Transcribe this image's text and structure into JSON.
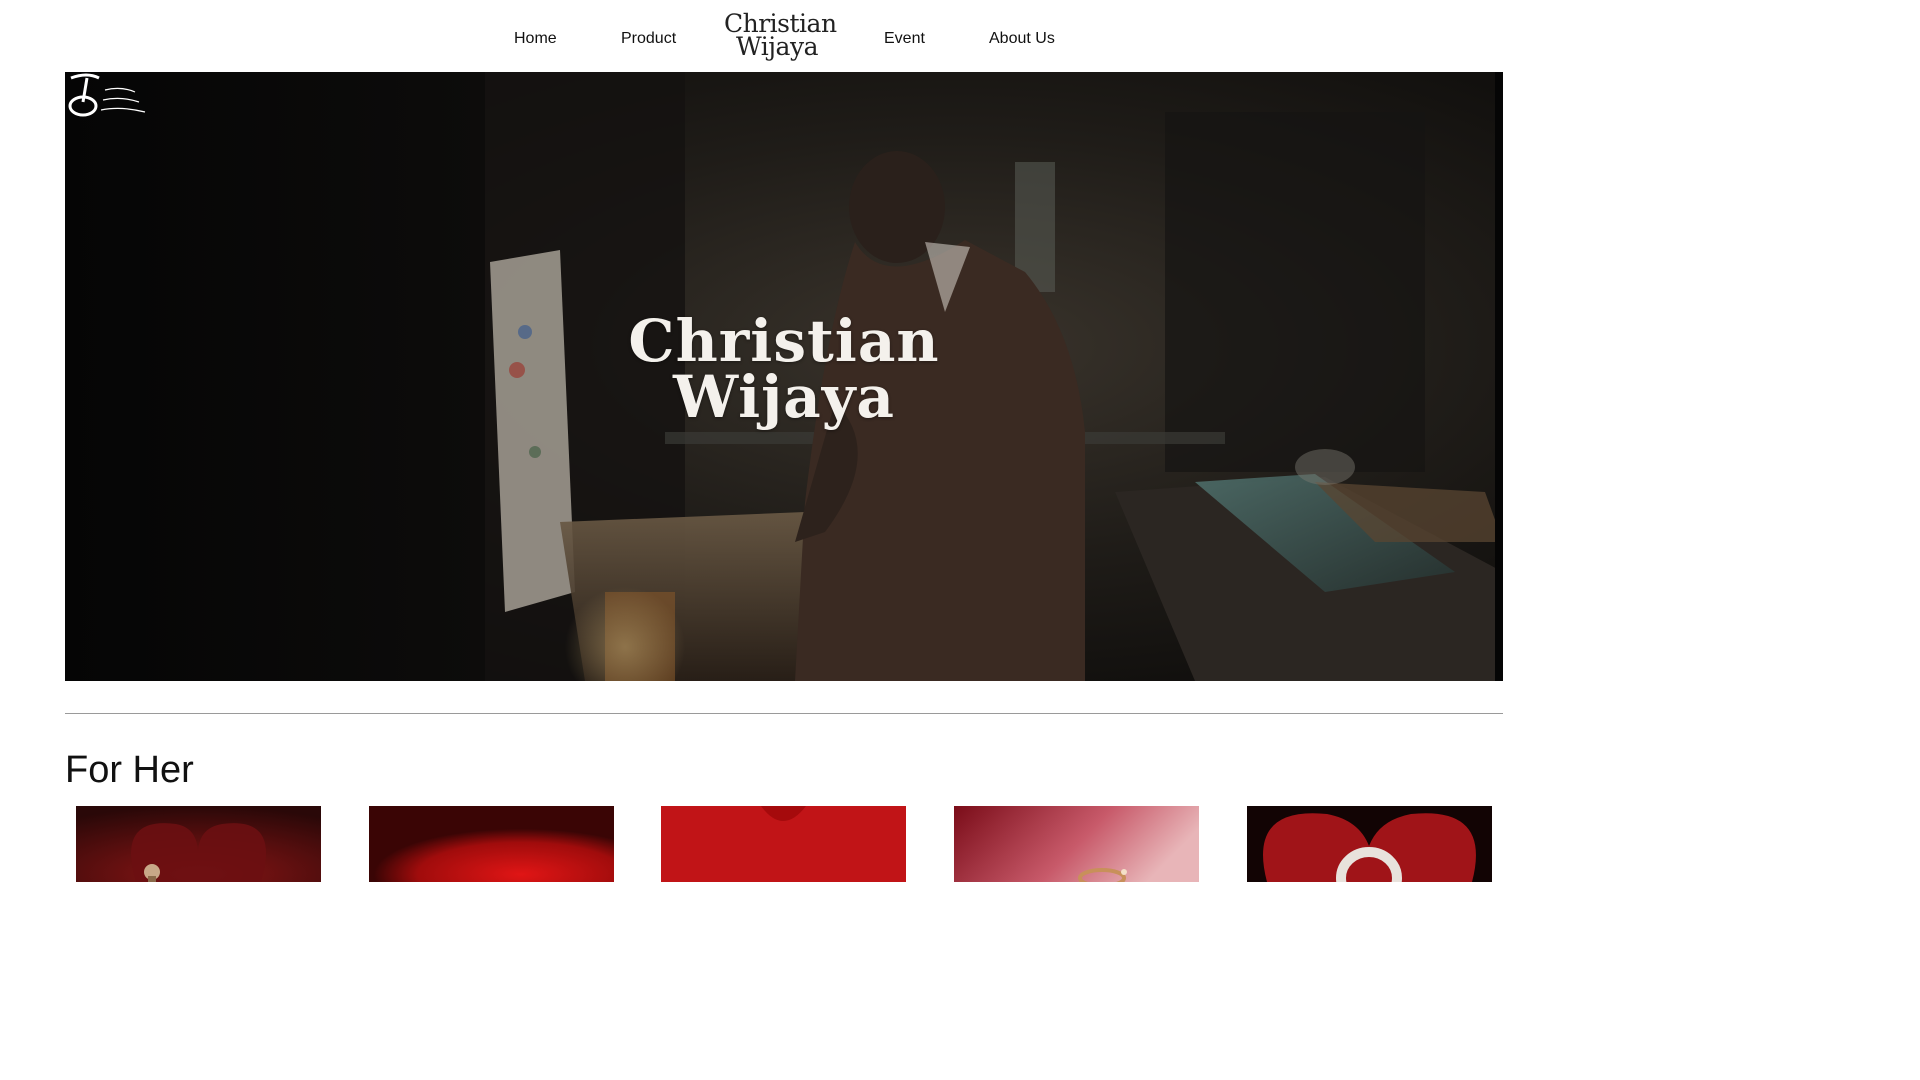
{
  "nav": {
    "home": "Home",
    "product": "Product",
    "event": "Event",
    "about": "About Us",
    "logo_line1": "Christian",
    "logo_line2": "Wijaya"
  },
  "hero": {
    "title_line1": "Christian",
    "title_line2": "Wijaya"
  },
  "sections": {
    "for_her": "For Her"
  },
  "colors": {
    "accent_red": "#b3121a",
    "background": "#ffffff",
    "divider": "#9a9a9a"
  },
  "icons": {
    "watermark": "production-logo-icon"
  }
}
